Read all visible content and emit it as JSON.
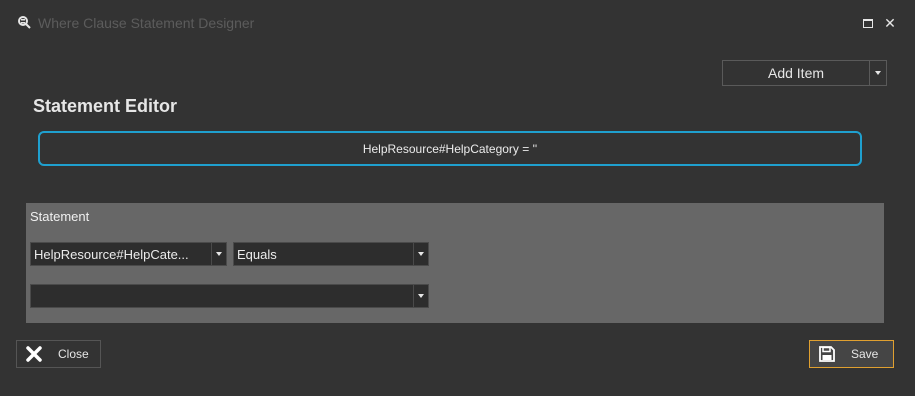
{
  "window": {
    "title": "Where Clause Statement Designer",
    "icons": {
      "app": "search-database-icon",
      "maximize": "maximize-icon",
      "close": "close-icon"
    }
  },
  "toolbar": {
    "add_item_label": "Add Item"
  },
  "editor": {
    "heading": "Statement Editor",
    "statement_text": "HelpResource#HelpCategory = ''"
  },
  "statement_panel": {
    "label": "Statement",
    "field_value": "HelpResource#HelpCate...",
    "operator_value": "Equals",
    "value_value": ""
  },
  "footer": {
    "close_label": "Close",
    "save_label": "Save"
  },
  "colors": {
    "background": "#333333",
    "panel": "#676767",
    "focus_border": "#1fa0cf",
    "save_border": "#e0a030"
  }
}
